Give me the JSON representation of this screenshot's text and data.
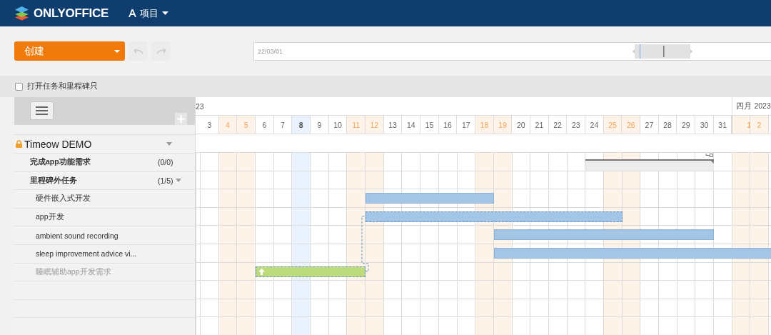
{
  "header": {
    "brand": "ONLYOFFICE",
    "nav_label": "项目"
  },
  "toolbar": {
    "create_label": "创建",
    "timeline_date": "22/03/01"
  },
  "filter": {
    "label": "打开任务和里程碑只",
    "checked": false
  },
  "gantt": {
    "months": [
      {
        "label": "23"
      },
      {
        "label": "四月 2023"
      }
    ],
    "days": [
      {
        "label": "3",
        "weekend": false,
        "today": false,
        "month_start": false
      },
      {
        "label": "4",
        "weekend": true,
        "today": false,
        "month_start": false
      },
      {
        "label": "5",
        "weekend": true,
        "today": false,
        "month_start": false
      },
      {
        "label": "6",
        "weekend": false,
        "today": false,
        "month_start": false
      },
      {
        "label": "7",
        "weekend": false,
        "today": false,
        "month_start": false
      },
      {
        "label": "8",
        "weekend": false,
        "today": true,
        "month_start": false
      },
      {
        "label": "9",
        "weekend": false,
        "today": false,
        "month_start": false
      },
      {
        "label": "10",
        "weekend": false,
        "today": false,
        "month_start": false
      },
      {
        "label": "11",
        "weekend": true,
        "today": false,
        "month_start": false
      },
      {
        "label": "12",
        "weekend": true,
        "today": false,
        "month_start": false
      },
      {
        "label": "13",
        "weekend": false,
        "today": false,
        "month_start": false
      },
      {
        "label": "14",
        "weekend": false,
        "today": false,
        "month_start": false
      },
      {
        "label": "15",
        "weekend": false,
        "today": false,
        "month_start": false
      },
      {
        "label": "16",
        "weekend": false,
        "today": false,
        "month_start": false
      },
      {
        "label": "17",
        "weekend": false,
        "today": false,
        "month_start": false
      },
      {
        "label": "18",
        "weekend": true,
        "today": false,
        "month_start": false
      },
      {
        "label": "19",
        "weekend": true,
        "today": false,
        "month_start": false
      },
      {
        "label": "20",
        "weekend": false,
        "today": false,
        "month_start": false
      },
      {
        "label": "21",
        "weekend": false,
        "today": false,
        "month_start": false
      },
      {
        "label": "22",
        "weekend": false,
        "today": false,
        "month_start": false
      },
      {
        "label": "23",
        "weekend": false,
        "today": false,
        "month_start": false
      },
      {
        "label": "24",
        "weekend": false,
        "today": false,
        "month_start": false
      },
      {
        "label": "25",
        "weekend": true,
        "today": false,
        "month_start": false
      },
      {
        "label": "26",
        "weekend": true,
        "today": false,
        "month_start": false
      },
      {
        "label": "27",
        "weekend": false,
        "today": false,
        "month_start": false
      },
      {
        "label": "28",
        "weekend": false,
        "today": false,
        "month_start": false
      },
      {
        "label": "29",
        "weekend": false,
        "today": false,
        "month_start": false
      },
      {
        "label": "30",
        "weekend": false,
        "today": false,
        "month_start": false
      },
      {
        "label": "31",
        "weekend": false,
        "today": false,
        "month_start": false
      },
      {
        "label": "1",
        "weekend": true,
        "today": false,
        "month_start": true
      },
      {
        "label": "2",
        "weekend": true,
        "today": false,
        "month_start": false
      }
    ],
    "project": {
      "name": "Timeow DEMO",
      "locked": true
    },
    "milestones": [
      {
        "name": "完成app功能需求",
        "count": "(0/0)",
        "expandable": false
      },
      {
        "name": "里程碑外任务",
        "count": "(1/5)",
        "expandable": true,
        "tasks": [
          {
            "name": "硬件嵌入式开发",
            "closed": false
          },
          {
            "name": "app开发",
            "closed": false
          },
          {
            "name": "ambient sound recording",
            "closed": false
          },
          {
            "name": "sleep improvement advice vi...",
            "closed": false
          },
          {
            "name": "睡眠辅助app开发需求",
            "closed": true
          }
        ]
      }
    ]
  }
}
